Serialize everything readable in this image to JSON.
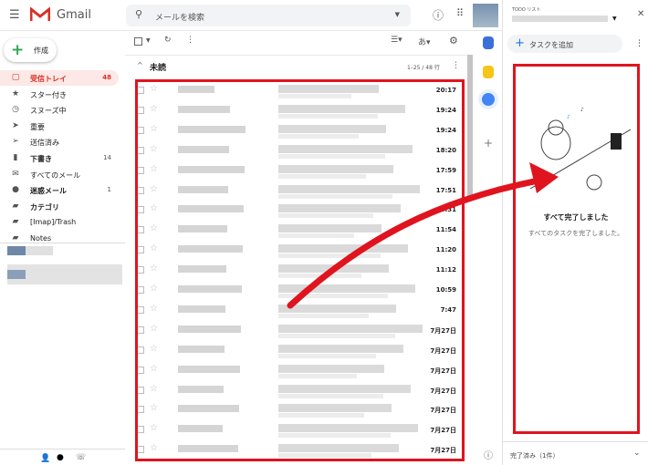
{
  "app": {
    "brand": "Gmail",
    "search_placeholder": "メールを検索"
  },
  "compose": {
    "label": "作成"
  },
  "sidebar": {
    "items": [
      {
        "icon": "inbox-icon",
        "glyph": "▢",
        "label": "受信トレイ",
        "count": "48",
        "active": true
      },
      {
        "icon": "star-icon",
        "glyph": "★",
        "label": "スター付き",
        "count": ""
      },
      {
        "icon": "clock-icon",
        "glyph": "◷",
        "label": "スヌーズ中",
        "count": ""
      },
      {
        "icon": "important-icon",
        "glyph": "➤",
        "label": "重要",
        "count": ""
      },
      {
        "icon": "send-icon",
        "glyph": "➢",
        "label": "送信済み",
        "count": ""
      },
      {
        "icon": "draft-icon",
        "glyph": "▮",
        "label": "下書き",
        "count": "14",
        "bold": true
      },
      {
        "icon": "mail-icon",
        "glyph": "✉",
        "label": "すべてのメール",
        "count": ""
      },
      {
        "icon": "spam-icon",
        "glyph": "●",
        "label": "迷惑メール",
        "count": "1",
        "bold": true
      },
      {
        "icon": "label-icon",
        "glyph": "▰",
        "label": "カテゴリ",
        "count": "",
        "bold": true
      },
      {
        "icon": "label-icon",
        "glyph": "▰",
        "label": "[Imap]/Trash",
        "count": ""
      },
      {
        "icon": "label-icon",
        "glyph": "▰",
        "label": "Notes",
        "count": ""
      }
    ]
  },
  "toolbar": {
    "lang": "あ",
    "pagination": "1–25 / 48 行"
  },
  "section": {
    "title": "未読"
  },
  "emails": {
    "times": [
      "20:17",
      "19:24",
      "19:24",
      "18:20",
      "17:59",
      "17:51",
      "14:31",
      "11:54",
      "11:20",
      "11:12",
      "10:59",
      "7:47",
      "7月27日",
      "7月27日",
      "7月27日",
      "7月27日",
      "7月27日",
      "7月27日",
      "7月27日"
    ]
  },
  "tasks": {
    "header": "TODO リスト",
    "add": "タスクを追加",
    "done_title": "すべて完了しました",
    "done_sub": "すべてのタスクを完了しました。",
    "completed": "完了済み（1件）"
  },
  "colors": {
    "annotation": "#e0141e",
    "accent": "#d93025"
  }
}
